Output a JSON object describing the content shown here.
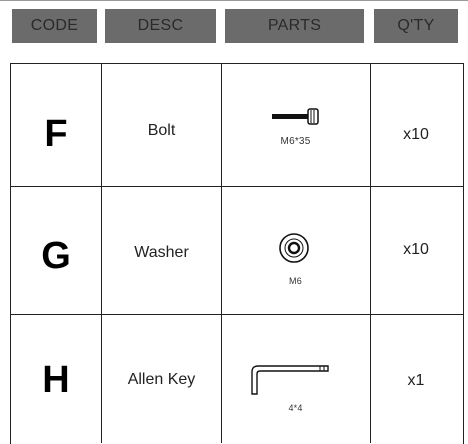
{
  "header": {
    "code": "CODE",
    "desc": "DESC",
    "parts": "PARTS",
    "qty": "Q'TY"
  },
  "rows": [
    {
      "code": "F",
      "desc": "Bolt",
      "part_icon": "bolt-icon",
      "part_spec": "M6*35",
      "qty": "x10"
    },
    {
      "code": "G",
      "desc": "Washer",
      "part_icon": "washer-icon",
      "part_spec": "M6",
      "qty": "x10"
    },
    {
      "code": "H",
      "desc": "Allen Key",
      "part_icon": "allen-key-icon",
      "part_spec": "4*4",
      "qty": "x1"
    }
  ],
  "colors": {
    "header_bg": "#6b6b6b",
    "header_text": "#2a2a2a",
    "border": "#222222"
  }
}
